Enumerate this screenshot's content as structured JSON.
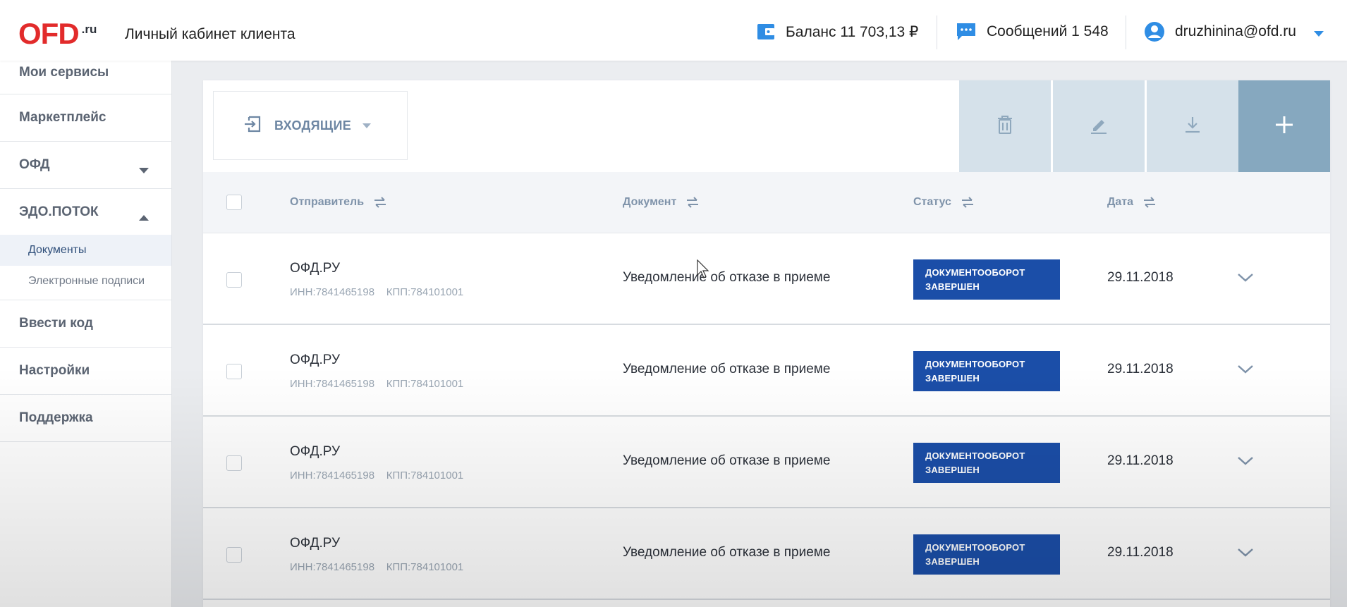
{
  "header": {
    "logo": "OFD",
    "logo_suffix": ".ru",
    "cabinet_title": "Личный кабинет клиента",
    "balance": "Баланс 11 703,13 ₽",
    "messages": "Сообщений 1 548",
    "user_email": "druzhinina@ofd.ru",
    "accent_color": "#e22b2b",
    "icon_color": "#2f8de4"
  },
  "sidebar": {
    "items": [
      {
        "label": "Мои сервисы"
      },
      {
        "label": "Маркетплейс"
      },
      {
        "label": "ОФД"
      },
      {
        "label": "ЭДО.ПОТОК"
      },
      {
        "label": "Ввести код"
      },
      {
        "label": "Настройки"
      },
      {
        "label": "Поддержка"
      }
    ],
    "edo_subitems": [
      {
        "label": "Документы",
        "active": true
      },
      {
        "label": "Электронные подписи",
        "active": false
      }
    ]
  },
  "toolbar": {
    "folder_label": "ВХОДЯЩИЕ",
    "delete_icon": "trash-icon",
    "edit_icon": "pencil-icon",
    "download_icon": "download-icon",
    "add_icon": "plus-icon"
  },
  "table": {
    "columns": [
      "Отправитель",
      "Документ",
      "Статус",
      "Дата"
    ],
    "rows": [
      {
        "sender": "ОФД.РУ",
        "ids": "ИНН:7841465198    КПП:784101001",
        "document": "Уведомление об отказе в приеме",
        "status_line1": "ДОКУМЕНТООБОРОТ",
        "status_line2": "ЗАВЕРШЕН",
        "date": "29.11.2018"
      },
      {
        "sender": "ОФД.РУ",
        "ids": "ИНН:7841465198    КПП:784101001",
        "document": "Уведомление об отказе в приеме",
        "status_line1": "ДОКУМЕНТООБОРОТ",
        "status_line2": "ЗАВЕРШЕН",
        "date": "29.11.2018"
      },
      {
        "sender": "ОФД.РУ",
        "ids": "ИНН:7841465198    КПП:784101001",
        "document": "Уведомление об отказе в приеме",
        "status_line1": "ДОКУМЕНТООБОРОТ",
        "status_line2": "ЗАВЕРШЕН",
        "date": "29.11.2018"
      },
      {
        "sender": "ОФД.РУ",
        "ids": "ИНН:7841465198    КПП:784101001",
        "document": "Уведомление об отказе в приеме",
        "status_line1": "ДОКУМЕНТООБОРОТ",
        "status_line2": "ЗАВЕРШЕН",
        "date": "29.11.2018"
      }
    ],
    "status_color": "#1b4ea8"
  }
}
